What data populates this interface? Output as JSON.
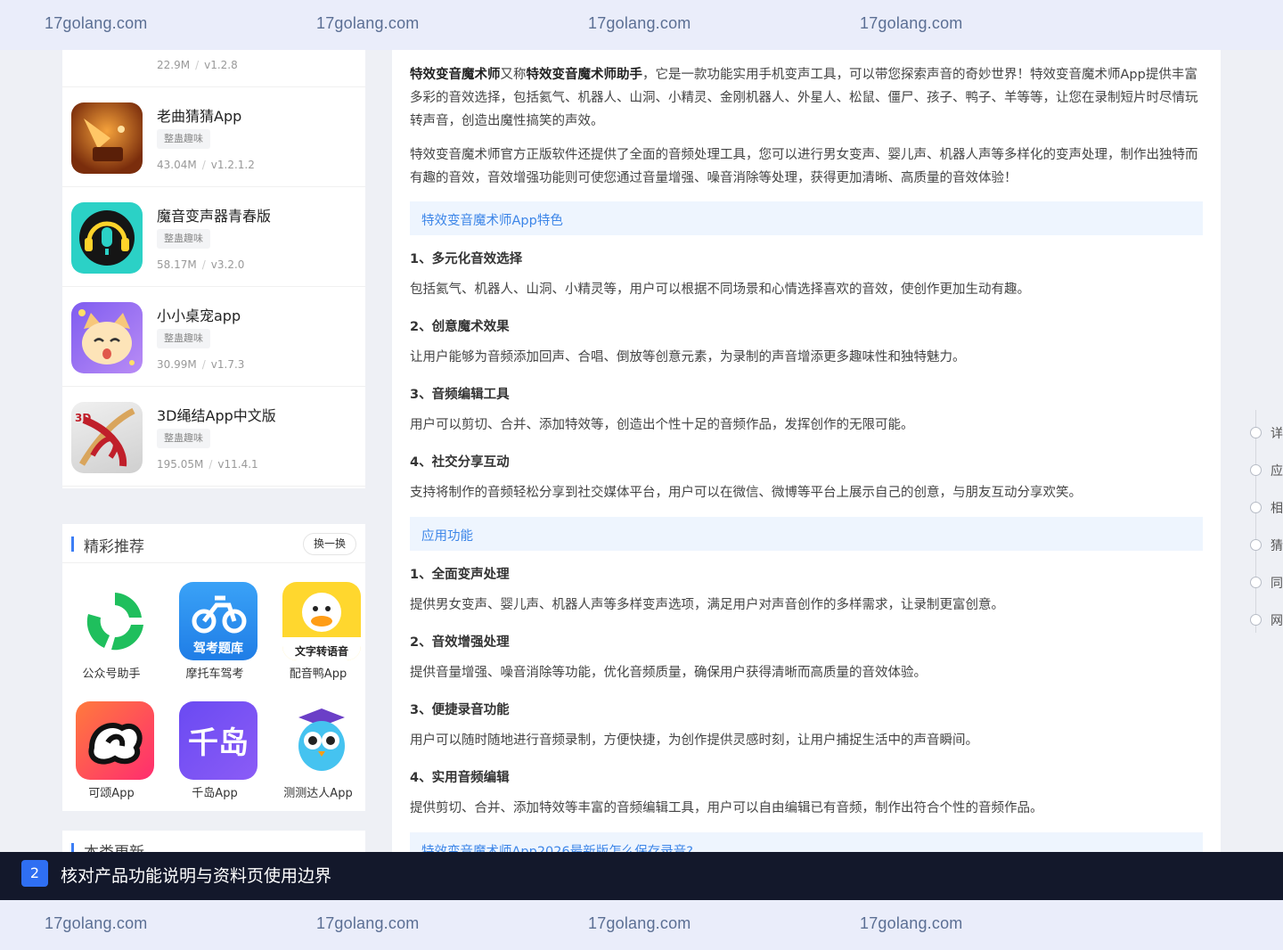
{
  "watermark": {
    "text": "17golang.com"
  },
  "app_list": [
    {
      "name": "",
      "tag": "",
      "size": "22.9M",
      "version": "v1.2.8"
    },
    {
      "name": "老曲猜猜App",
      "tag": "整蛊趣味",
      "size": "43.04M",
      "version": "v1.2.1.2"
    },
    {
      "name": "魔音变声器青春版",
      "tag": "整蛊趣味",
      "size": "58.17M",
      "version": "v3.2.0"
    },
    {
      "name": "小小桌宠app",
      "tag": "整蛊趣味",
      "size": "30.99M",
      "version": "v1.7.3"
    },
    {
      "name": "3D绳结App中文版",
      "tag": "整蛊趣味",
      "size": "195.05M",
      "version": "v11.4.1"
    }
  ],
  "recommend": {
    "title": "精彩推荐",
    "swap_label": "换一换",
    "items": [
      {
        "label": "公众号助手",
        "icon_text": ""
      },
      {
        "label": "摩托车驾考",
        "icon_text": "驾考题库"
      },
      {
        "label": "配音鸭App",
        "icon_text": "文字转语音"
      },
      {
        "label": "可颂App",
        "icon_text": ""
      },
      {
        "label": "千岛App",
        "icon_text": "千岛"
      },
      {
        "label": "测测达人App",
        "icon_text": ""
      }
    ]
  },
  "category_update": {
    "title": "本类更新"
  },
  "article": {
    "intro1_bold1": "特效变音魔术师",
    "intro1_mid": "又称",
    "intro1_bold2": "特效变音魔术师助手",
    "intro1_rest": "，它是一款功能实用手机变声工具，可以带您探索声音的奇妙世界！特效变音魔术师App提供丰富多彩的音效选择，包括氦气、机器人、山洞、小精灵、金刚机器人、外星人、松鼠、僵尸、孩子、鸭子、羊等等，让您在录制短片时尽情玩转声音，创造出魔性搞笑的声效。",
    "intro2": "特效变音魔术师官方正版软件还提供了全面的音频处理工具，您可以进行男女变声、婴儿声、机器人声等多样化的变声处理，制作出独特而有趣的音效，音效增强功能则可使您通过音量增强、噪音消除等处理，获得更加清晰、高质量的音效体验！",
    "sections": [
      {
        "title": "特效变音魔术师App特色",
        "items": [
          {
            "heading": "1、多元化音效选择",
            "text": "包括氦气、机器人、山洞、小精灵等，用户可以根据不同场景和心情选择喜欢的音效，使创作更加生动有趣。"
          },
          {
            "heading": "2、创意魔术效果",
            "text": "让用户能够为音频添加回声、合唱、倒放等创意元素，为录制的声音增添更多趣味性和独特魅力。"
          },
          {
            "heading": "3、音频编辑工具",
            "text": "用户可以剪切、合并、添加特效等，创造出个性十足的音频作品，发挥创作的无限可能。"
          },
          {
            "heading": "4、社交分享互动",
            "text": "支持将制作的音频轻松分享到社交媒体平台，用户可以在微信、微博等平台上展示自己的创意，与朋友互动分享欢笑。"
          }
        ]
      },
      {
        "title": "应用功能",
        "items": [
          {
            "heading": "1、全面变声处理",
            "text": "提供男女变声、婴儿声、机器人声等多样变声选项，满足用户对声音创作的多样需求，让录制更富创意。"
          },
          {
            "heading": "2、音效增强处理",
            "text": "提供音量增强、噪音消除等功能，优化音频质量，确保用户获得清晰而高质量的音效体验。"
          },
          {
            "heading": "3、便捷录音功能",
            "text": "用户可以随时随地进行音频录制，方便快捷，为创作提供灵感时刻，让用户捕捉生活中的声音瞬间。"
          },
          {
            "heading": "4、实用音频编辑",
            "text": "提供剪切、合并、添加特效等丰富的音频编辑工具，用户可以自由编辑已有音频，制作出符合个性的音频作品。"
          }
        ]
      },
      {
        "title": "特效变音魔术师App2026最新版怎么保存录音?",
        "items": []
      }
    ]
  },
  "right_nav": [
    "详",
    "应",
    "相",
    "猜",
    "同",
    "网"
  ],
  "tooltip": {
    "number": "2",
    "text": "核对产品功能说明与资料页使用边界"
  }
}
